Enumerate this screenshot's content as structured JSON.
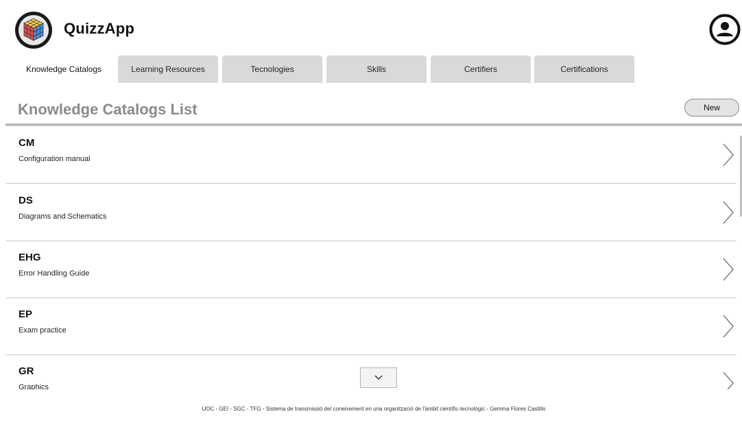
{
  "app": {
    "title": "QuizzApp"
  },
  "tabs": [
    {
      "label": "Knowledge Catalogs",
      "active": true
    },
    {
      "label": "Learning Resources",
      "active": false
    },
    {
      "label": "Tecnologies",
      "active": false
    },
    {
      "label": "Skills",
      "active": false
    },
    {
      "label": "Certifiers",
      "active": false
    },
    {
      "label": "Certifications",
      "active": false
    }
  ],
  "list": {
    "title": "Knowledge Catalogs List",
    "new_label": "New",
    "items": [
      {
        "code": "CM",
        "description": "Configuration manual"
      },
      {
        "code": "DS",
        "description": "Diagrams and Schematics"
      },
      {
        "code": "EHG",
        "description": "Error Handling Guide"
      },
      {
        "code": "EP",
        "description": "Exam practice"
      },
      {
        "code": "GR",
        "description": "Graphics"
      }
    ]
  },
  "footer": {
    "text": "UOC - GEI - SGC - TFG - Sistema de transmissió del coneixement en una organització de l'àmbit científic-tecnològic - Gemma Flores Castillo"
  },
  "icons": {
    "logo": "rubiks-cube-icon",
    "user": "user-account-icon",
    "chevron_row": "chevron-right-icon",
    "scroll_down": "chevron-down-icon"
  },
  "colors": {
    "tab_inactive": "#d9d9d9",
    "title_gray": "#8a8a8a",
    "new_button_bg": "#e4e4e4"
  }
}
